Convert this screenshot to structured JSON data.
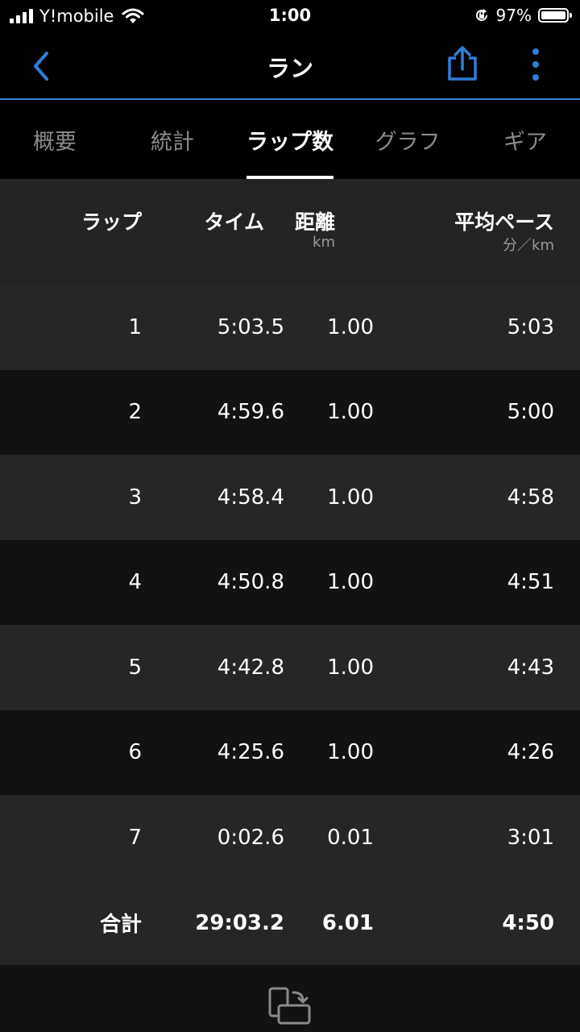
{
  "status_bar": {
    "carrier": "Y!mobile",
    "time": "1:00",
    "battery_percent": "97%",
    "battery_level": 0.97,
    "icons": [
      "signal-icon",
      "wifi-icon",
      "orientation-lock-icon",
      "battery-icon"
    ]
  },
  "nav": {
    "title": "ラン",
    "icons": [
      "back-chevron-icon",
      "share-icon",
      "more-vertical-icon"
    ],
    "accent_color": "#2f7fd8"
  },
  "tabs": [
    {
      "label": "概要",
      "active": false
    },
    {
      "label": "統計",
      "active": false
    },
    {
      "label": "ラップ数",
      "active": true
    },
    {
      "label": "グラフ",
      "active": false
    },
    {
      "label": "ギア",
      "active": false
    }
  ],
  "table": {
    "headers": {
      "lap": "ラップ",
      "time": "タイム",
      "distance": "距離",
      "distance_unit": "km",
      "pace": "平均ペース",
      "pace_unit": "分／km"
    },
    "rows": [
      {
        "lap": "1",
        "time": "5:03.5",
        "distance": "1.00",
        "pace": "5:03"
      },
      {
        "lap": "2",
        "time": "4:59.6",
        "distance": "1.00",
        "pace": "5:00"
      },
      {
        "lap": "3",
        "time": "4:58.4",
        "distance": "1.00",
        "pace": "4:58"
      },
      {
        "lap": "4",
        "time": "4:50.8",
        "distance": "1.00",
        "pace": "4:51"
      },
      {
        "lap": "5",
        "time": "4:42.8",
        "distance": "1.00",
        "pace": "4:43"
      },
      {
        "lap": "6",
        "time": "4:25.6",
        "distance": "1.00",
        "pace": "4:26"
      },
      {
        "lap": "7",
        "time": "0:02.6",
        "distance": "0.01",
        "pace": "3:01"
      }
    ],
    "total": {
      "label": "合計",
      "time": "29:03.2",
      "distance": "6.01",
      "pace": "4:50"
    }
  },
  "bottom": {
    "icon": "rotate-device-icon"
  }
}
